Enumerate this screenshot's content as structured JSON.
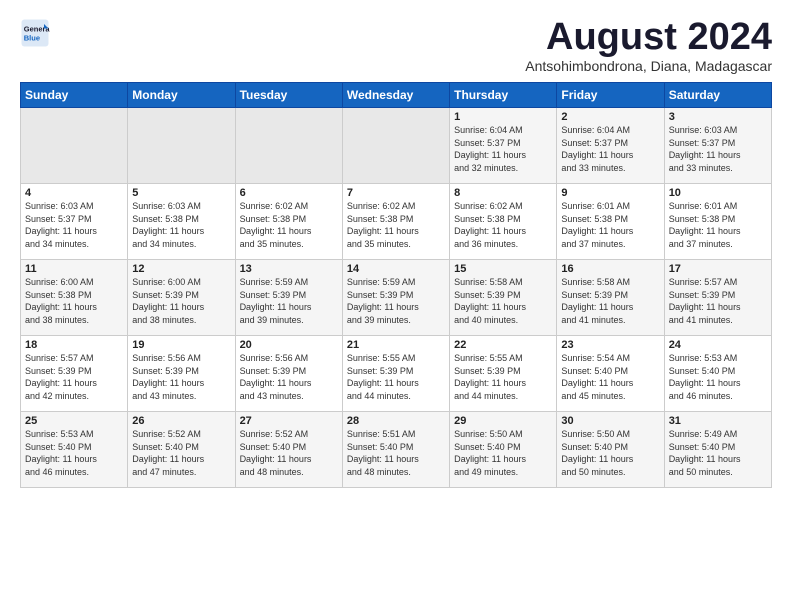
{
  "logo": {
    "line1": "General",
    "line2": "Blue"
  },
  "title": "August 2024",
  "location": "Antsohimbondrona, Diana, Madagascar",
  "days_header": [
    "Sunday",
    "Monday",
    "Tuesday",
    "Wednesday",
    "Thursday",
    "Friday",
    "Saturday"
  ],
  "weeks": [
    [
      {
        "day": "",
        "info": ""
      },
      {
        "day": "",
        "info": ""
      },
      {
        "day": "",
        "info": ""
      },
      {
        "day": "",
        "info": ""
      },
      {
        "day": "1",
        "info": "Sunrise: 6:04 AM\nSunset: 5:37 PM\nDaylight: 11 hours\nand 32 minutes."
      },
      {
        "day": "2",
        "info": "Sunrise: 6:04 AM\nSunset: 5:37 PM\nDaylight: 11 hours\nand 33 minutes."
      },
      {
        "day": "3",
        "info": "Sunrise: 6:03 AM\nSunset: 5:37 PM\nDaylight: 11 hours\nand 33 minutes."
      }
    ],
    [
      {
        "day": "4",
        "info": "Sunrise: 6:03 AM\nSunset: 5:37 PM\nDaylight: 11 hours\nand 34 minutes."
      },
      {
        "day": "5",
        "info": "Sunrise: 6:03 AM\nSunset: 5:38 PM\nDaylight: 11 hours\nand 34 minutes."
      },
      {
        "day": "6",
        "info": "Sunrise: 6:02 AM\nSunset: 5:38 PM\nDaylight: 11 hours\nand 35 minutes."
      },
      {
        "day": "7",
        "info": "Sunrise: 6:02 AM\nSunset: 5:38 PM\nDaylight: 11 hours\nand 35 minutes."
      },
      {
        "day": "8",
        "info": "Sunrise: 6:02 AM\nSunset: 5:38 PM\nDaylight: 11 hours\nand 36 minutes."
      },
      {
        "day": "9",
        "info": "Sunrise: 6:01 AM\nSunset: 5:38 PM\nDaylight: 11 hours\nand 37 minutes."
      },
      {
        "day": "10",
        "info": "Sunrise: 6:01 AM\nSunset: 5:38 PM\nDaylight: 11 hours\nand 37 minutes."
      }
    ],
    [
      {
        "day": "11",
        "info": "Sunrise: 6:00 AM\nSunset: 5:38 PM\nDaylight: 11 hours\nand 38 minutes."
      },
      {
        "day": "12",
        "info": "Sunrise: 6:00 AM\nSunset: 5:39 PM\nDaylight: 11 hours\nand 38 minutes."
      },
      {
        "day": "13",
        "info": "Sunrise: 5:59 AM\nSunset: 5:39 PM\nDaylight: 11 hours\nand 39 minutes."
      },
      {
        "day": "14",
        "info": "Sunrise: 5:59 AM\nSunset: 5:39 PM\nDaylight: 11 hours\nand 39 minutes."
      },
      {
        "day": "15",
        "info": "Sunrise: 5:58 AM\nSunset: 5:39 PM\nDaylight: 11 hours\nand 40 minutes."
      },
      {
        "day": "16",
        "info": "Sunrise: 5:58 AM\nSunset: 5:39 PM\nDaylight: 11 hours\nand 41 minutes."
      },
      {
        "day": "17",
        "info": "Sunrise: 5:57 AM\nSunset: 5:39 PM\nDaylight: 11 hours\nand 41 minutes."
      }
    ],
    [
      {
        "day": "18",
        "info": "Sunrise: 5:57 AM\nSunset: 5:39 PM\nDaylight: 11 hours\nand 42 minutes."
      },
      {
        "day": "19",
        "info": "Sunrise: 5:56 AM\nSunset: 5:39 PM\nDaylight: 11 hours\nand 43 minutes."
      },
      {
        "day": "20",
        "info": "Sunrise: 5:56 AM\nSunset: 5:39 PM\nDaylight: 11 hours\nand 43 minutes."
      },
      {
        "day": "21",
        "info": "Sunrise: 5:55 AM\nSunset: 5:39 PM\nDaylight: 11 hours\nand 44 minutes."
      },
      {
        "day": "22",
        "info": "Sunrise: 5:55 AM\nSunset: 5:39 PM\nDaylight: 11 hours\nand 44 minutes."
      },
      {
        "day": "23",
        "info": "Sunrise: 5:54 AM\nSunset: 5:40 PM\nDaylight: 11 hours\nand 45 minutes."
      },
      {
        "day": "24",
        "info": "Sunrise: 5:53 AM\nSunset: 5:40 PM\nDaylight: 11 hours\nand 46 minutes."
      }
    ],
    [
      {
        "day": "25",
        "info": "Sunrise: 5:53 AM\nSunset: 5:40 PM\nDaylight: 11 hours\nand 46 minutes."
      },
      {
        "day": "26",
        "info": "Sunrise: 5:52 AM\nSunset: 5:40 PM\nDaylight: 11 hours\nand 47 minutes."
      },
      {
        "day": "27",
        "info": "Sunrise: 5:52 AM\nSunset: 5:40 PM\nDaylight: 11 hours\nand 48 minutes."
      },
      {
        "day": "28",
        "info": "Sunrise: 5:51 AM\nSunset: 5:40 PM\nDaylight: 11 hours\nand 48 minutes."
      },
      {
        "day": "29",
        "info": "Sunrise: 5:50 AM\nSunset: 5:40 PM\nDaylight: 11 hours\nand 49 minutes."
      },
      {
        "day": "30",
        "info": "Sunrise: 5:50 AM\nSunset: 5:40 PM\nDaylight: 11 hours\nand 50 minutes."
      },
      {
        "day": "31",
        "info": "Sunrise: 5:49 AM\nSunset: 5:40 PM\nDaylight: 11 hours\nand 50 minutes."
      }
    ]
  ]
}
